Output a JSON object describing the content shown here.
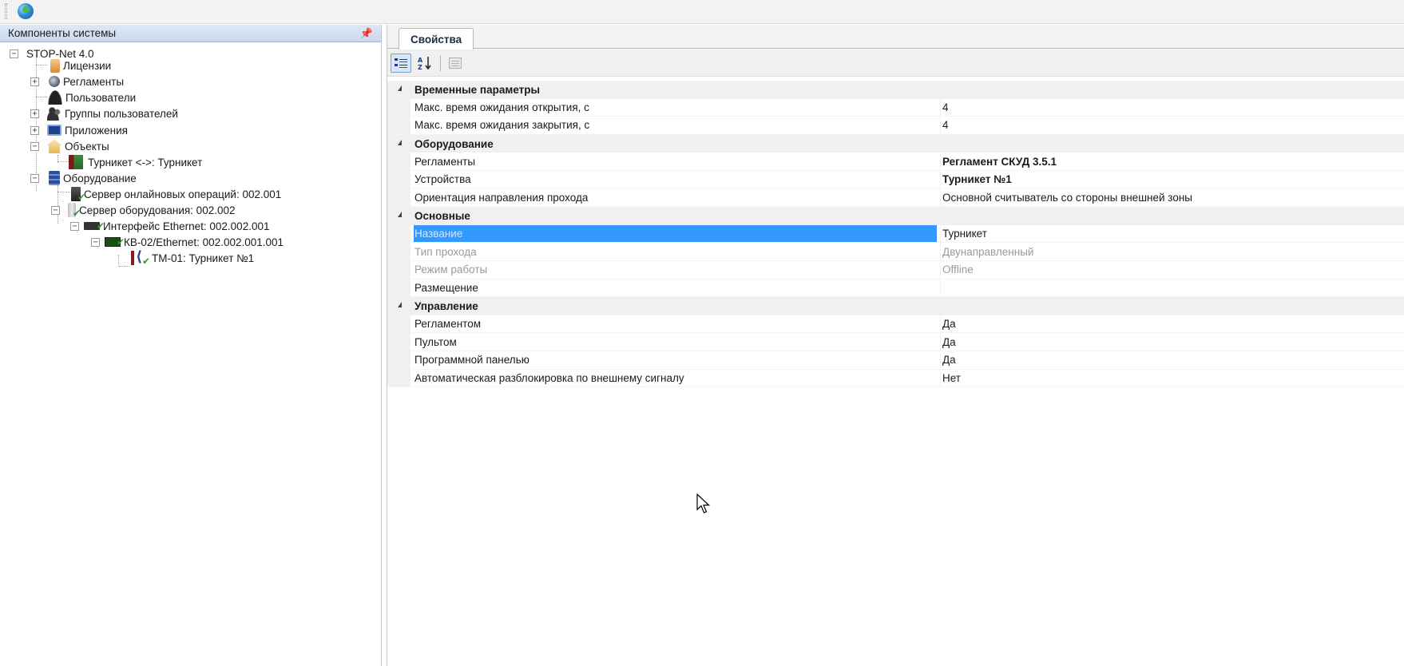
{
  "left_panel": {
    "title": "Компоненты системы",
    "tree": [
      {
        "id": "root",
        "label": "STOP-Net 4.0"
      },
      {
        "id": "licenses",
        "label": "Лицензии"
      },
      {
        "id": "reglaments",
        "label": "Регламенты"
      },
      {
        "id": "users",
        "label": "Пользователи"
      },
      {
        "id": "user_groups",
        "label": "Группы пользователей"
      },
      {
        "id": "apps",
        "label": "Приложения"
      },
      {
        "id": "objects",
        "label": "Объекты"
      },
      {
        "id": "turnstile_obj",
        "label": "Турникет <->: Турникет"
      },
      {
        "id": "equipment",
        "label": "Оборудование"
      },
      {
        "id": "online_server",
        "label": "Сервер онлайновых операций: 002.001"
      },
      {
        "id": "equip_server",
        "label": "Сервер оборудования: 002.002"
      },
      {
        "id": "eth_iface",
        "label": "Интерфейс Ethernet: 002.002.001"
      },
      {
        "id": "kb02",
        "label": "КВ-02/Ethernet: 002.002.001.001"
      },
      {
        "id": "tm01",
        "label": "ТМ-01: Турникет №1"
      }
    ]
  },
  "right_panel": {
    "tab_label": "Свойства",
    "toolbar": {
      "categorized_icon": "categorized-icon",
      "alpha_sort_icon": "alpha-sort-icon",
      "property_pages_icon": "property-pages-icon"
    },
    "grid": [
      {
        "type": "category",
        "title": "Временные параметры"
      },
      {
        "type": "prop",
        "name": "Макс. время ожидания открытия, с",
        "value": "4"
      },
      {
        "type": "prop",
        "name": "Макс. время ожидания закрытия, с",
        "value": "4"
      },
      {
        "type": "category",
        "title": "Оборудование"
      },
      {
        "type": "prop",
        "name": "Регламенты",
        "value": "Регламент СКУД 3.5.1",
        "bold": true
      },
      {
        "type": "prop",
        "name": "Устройства",
        "value": "Турникет №1",
        "bold": true
      },
      {
        "type": "prop",
        "name": "Ориентация направления прохода",
        "value": "Основной считыватель со стороны внешней зоны"
      },
      {
        "type": "category",
        "title": "Основные"
      },
      {
        "type": "prop",
        "name": "Название",
        "value": "Турникет",
        "selected": true
      },
      {
        "type": "prop",
        "name": "Тип прохода",
        "value": "Двунаправленный",
        "readonly": true
      },
      {
        "type": "prop",
        "name": "Режим работы",
        "value": "Offline",
        "readonly": true
      },
      {
        "type": "prop",
        "name": "Размещение",
        "value": ""
      },
      {
        "type": "category",
        "title": "Управление"
      },
      {
        "type": "prop",
        "name": "Регламентом",
        "value": "Да"
      },
      {
        "type": "prop",
        "name": "Пультом",
        "value": "Да"
      },
      {
        "type": "prop",
        "name": "Программной панелью",
        "value": "Да"
      },
      {
        "type": "prop",
        "name": "Автоматическая разблокировка по внешнему сигналу",
        "value": "Нет"
      }
    ]
  },
  "colors": {
    "selection": "#3399ff",
    "category_bg": "#f0f0f0",
    "header_bg": "#c9d8ee"
  }
}
